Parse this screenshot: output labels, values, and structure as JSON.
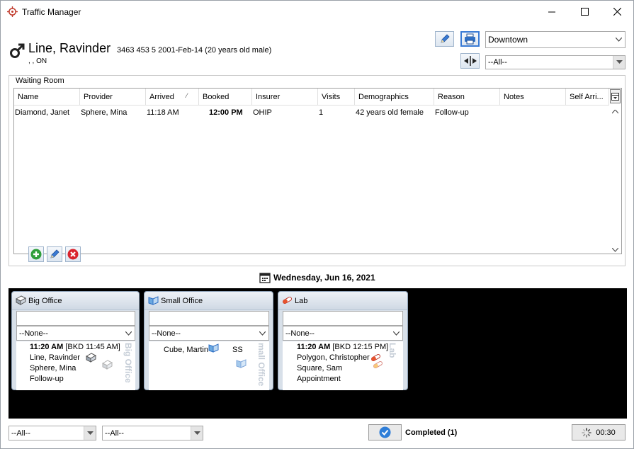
{
  "window": {
    "title": "Traffic Manager",
    "icon": "crosshair-icon"
  },
  "patient": {
    "name": "Line, Ravinder",
    "details": "3463 453 5  2001-Feb-14 (20 years old male)",
    "address": ", , ON",
    "gender_icon": "male-icon"
  },
  "toolbar": {
    "edit_icon": "pencil-icon",
    "print_icon": "printer-icon",
    "split_icon": "split-view-icon"
  },
  "location_select": {
    "value": "Downtown"
  },
  "top_filter": {
    "value": "--All--"
  },
  "waiting_room": {
    "title": "Waiting Room",
    "columns": [
      "Name",
      "Provider",
      "Arrived",
      "Booked",
      "Insurer",
      "Visits",
      "Demographics",
      "Reason",
      "Notes",
      "Self Arri..."
    ],
    "sort_indicator": "⁄",
    "rows": [
      [
        "Diamond, Janet",
        "Sphere, Mina",
        "11:18 AM",
        "12:00 PM",
        "OHIP",
        "1",
        "42 years old female",
        "Follow-up",
        "",
        ""
      ]
    ]
  },
  "date": "Wednesday, Jun 16, 2021",
  "rooms": [
    {
      "name": "Big Office",
      "select": "--None--",
      "vertical_label": "Big Office",
      "appointments": [
        {
          "time": "11:20 AM",
          "booked": " [BKD 11:45 AM]",
          "lines": [
            "Line, Ravinder",
            "Sphere, Mina",
            "Follow-up"
          ]
        }
      ]
    },
    {
      "name": "Small Office",
      "select": "--None--",
      "vertical_label": "mall Office",
      "appointments": [
        {
          "patient": "Cube, Martin",
          "tag": "SS"
        }
      ]
    },
    {
      "name": "Lab",
      "select": "--None--",
      "vertical_label": "Lab",
      "appointments": [
        {
          "time": "11:20 AM",
          "booked": " [BKD 12:15 PM]",
          "lines": [
            "Polygon, Christopher",
            "Square, Sam",
            "Appointment"
          ]
        }
      ]
    }
  ],
  "bottom": {
    "filter1": "--All--",
    "filter2": "--All--",
    "completed": "Completed (1)",
    "timer": "00:30"
  },
  "colors": {
    "accent": "#3a7bd5",
    "room_panel": "#d8e0e9",
    "board_bg": "#000000"
  }
}
